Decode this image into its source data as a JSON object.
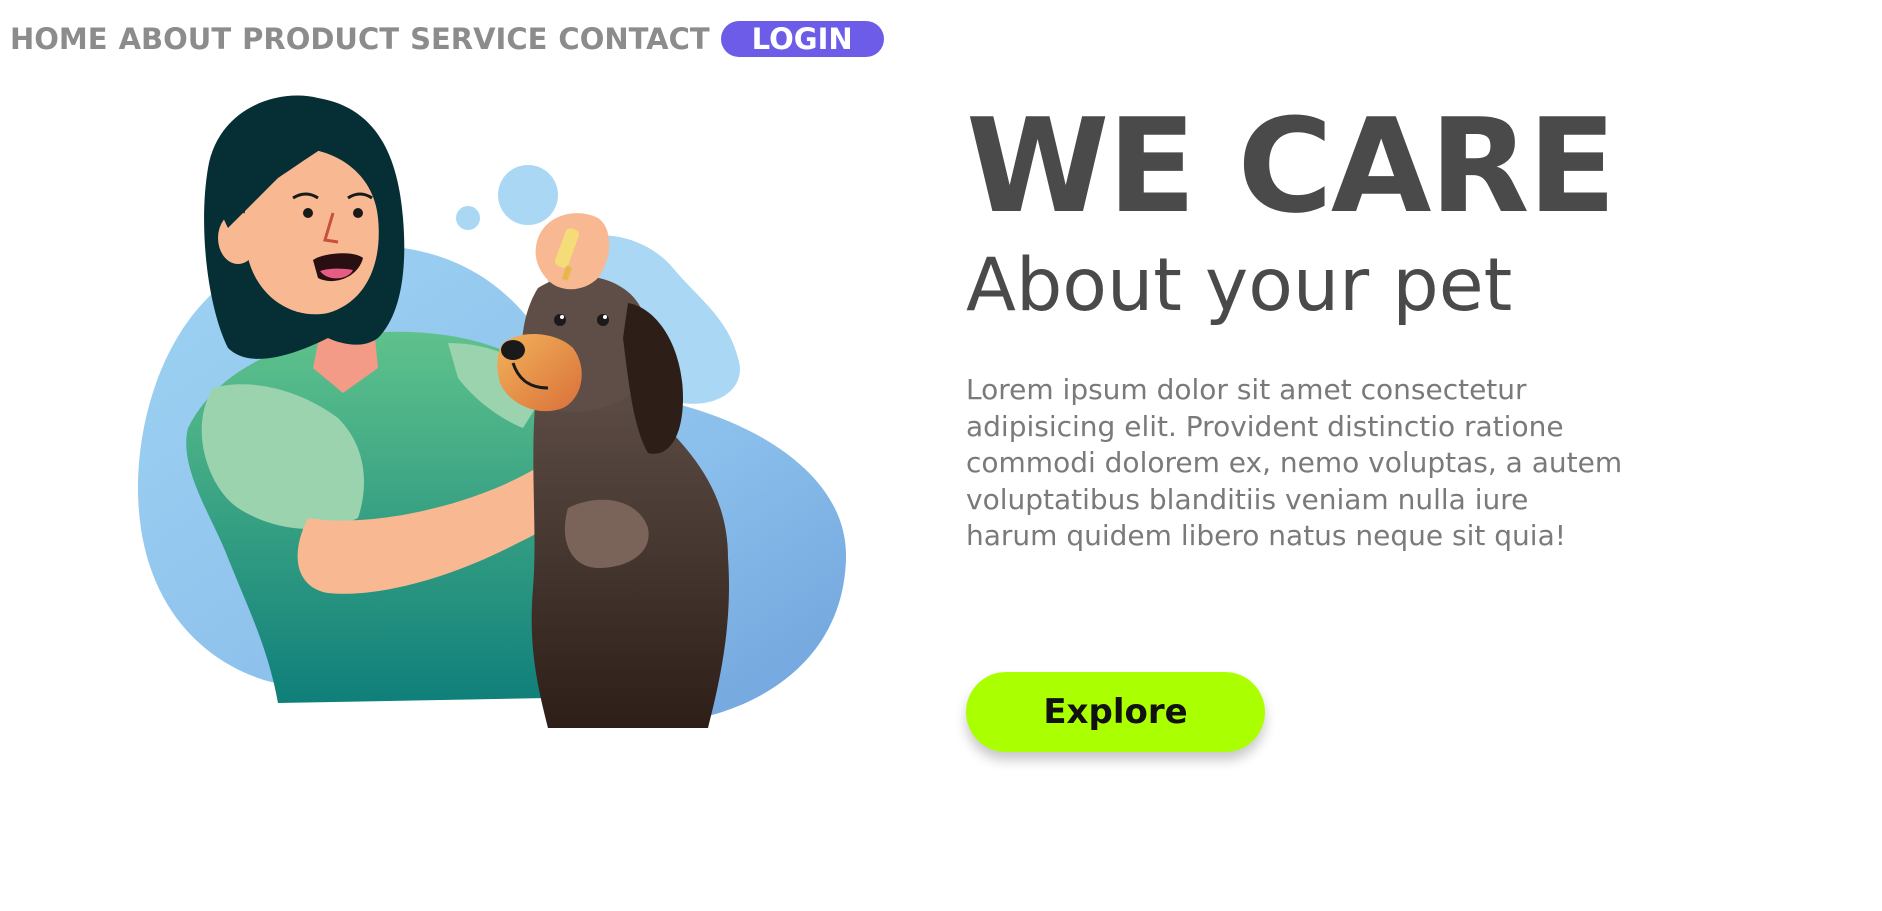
{
  "nav": {
    "links": [
      "HOME",
      "ABOUT",
      "PRODUCT",
      "SERVICE",
      "CONTACT"
    ],
    "login_label": "LOGIN"
  },
  "hero": {
    "title": "WE CARE",
    "subtitle": "About your pet",
    "body": "Lorem ipsum dolor sit amet consectetur adipisicing elit. Provident distinctio ratione commodi dolorem ex, nemo voluptas, a autem voluptatibus blanditiis veniam nulla iure harum quidem libero natus neque sit quia!",
    "explore_label": "Explore"
  },
  "illustration": {
    "icon": "vet-with-dog-illustration"
  },
  "colors": {
    "accent": "#6c5ce7",
    "cta": "#aaff00",
    "text_dark": "#4a4a4a",
    "text_muted": "#7a7a7a",
    "nav_text": "#8c8c8c"
  }
}
